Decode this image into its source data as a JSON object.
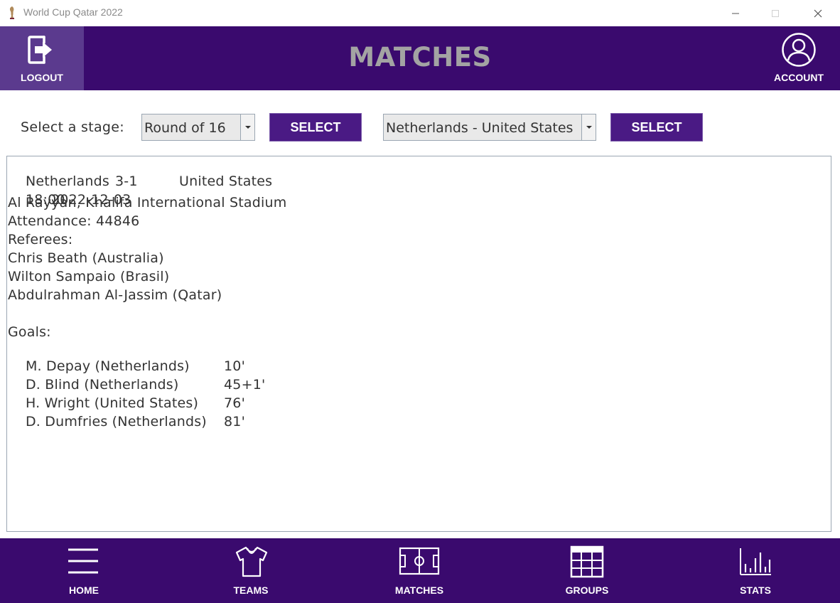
{
  "window": {
    "title": "World Cup Qatar 2022",
    "icon": "trophy-icon"
  },
  "header": {
    "logout_label": "LOGOUT",
    "title": "MATCHES",
    "account_label": "ACCOUNT"
  },
  "controls": {
    "stage_label": "Select a stage:",
    "stage_value": "Round of 16",
    "select_label": "SELECT",
    "match_value": "Netherlands - United States",
    "select_label_2": "SELECT"
  },
  "details": {
    "home_team": "Netherlands",
    "score": "3-1",
    "away_team": "United States",
    "time": "18:00",
    "date": "2022-12-03",
    "venue": "Al Rayyan, Khalifa International Stadium",
    "attendance": "Attendance: 44846",
    "referees_label": "Referees:",
    "referees": [
      "Chris Beath (Australia)",
      "Wilton Sampaio (Brasil)",
      "Abdulrahman Al-Jassim (Qatar)"
    ],
    "goals_label": "Goals:",
    "goals": [
      {
        "player": "M. Depay (Netherlands)",
        "minute": "10'"
      },
      {
        "player": "D. Blind (Netherlands)",
        "minute": "45+1'"
      },
      {
        "player": "H. Wright (United States)",
        "minute": "76'"
      },
      {
        "player": "D. Dumfries (Netherlands)",
        "minute": "81'"
      }
    ]
  },
  "nav": {
    "items": [
      {
        "label": "HOME",
        "icon": "hamburger-menu-icon"
      },
      {
        "label": "TEAMS",
        "icon": "shirt-icon"
      },
      {
        "label": "MATCHES",
        "icon": "football-pitch-icon"
      },
      {
        "label": "GROUPS",
        "icon": "grid-table-icon"
      },
      {
        "label": "STATS",
        "icon": "bar-chart-icon"
      }
    ]
  },
  "colors": {
    "header_bg": "#3a0a6e",
    "logout_bg": "#5b3a8e",
    "button_bg": "#4a1a84",
    "title_text": "#a3a3a3"
  }
}
